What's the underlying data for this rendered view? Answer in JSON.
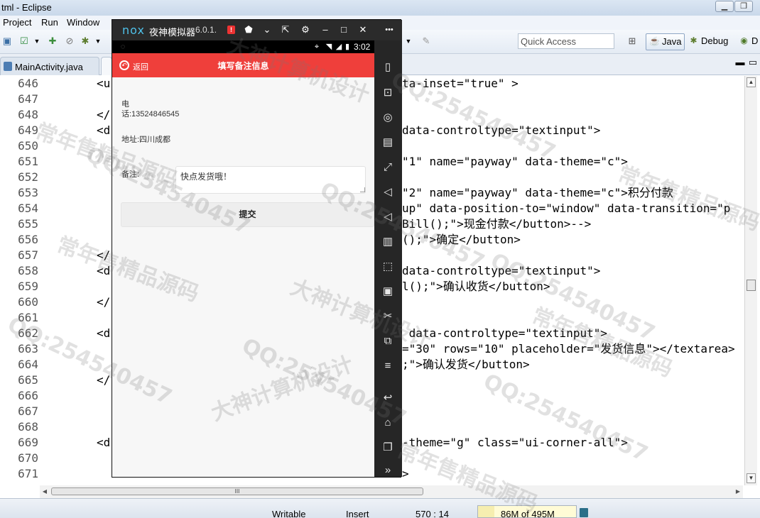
{
  "window": {
    "title": "tml - Eclipse",
    "menu": [
      "Project",
      "Run",
      "Window"
    ]
  },
  "toolbar": {
    "quick_access_placeholder": "Quick Access",
    "perspectives": [
      "Java",
      "Debug",
      "D"
    ]
  },
  "tabs": [
    {
      "label": "MainActivity.java"
    }
  ],
  "editor": {
    "lines": [
      {
        "num": "646",
        "code": "<u",
        "code_right": "ta-inset=\"true\" >"
      },
      {
        "num": "647",
        "code": "",
        "code_right": ""
      },
      {
        "num": "648",
        "code": "</",
        "code_right": ""
      },
      {
        "num": "649",
        "code": "<d",
        "code_right": "data-controltype=\"textinput\">"
      },
      {
        "num": "650",
        "code": "",
        "code_right": ""
      },
      {
        "num": "651",
        "code": "",
        "code_right": "\"1\" name=\"payway\" data-theme=\"c\">"
      },
      {
        "num": "652",
        "code": "",
        "code_right": ""
      },
      {
        "num": "653",
        "code": "",
        "code_right": "\"2\" name=\"payway\" data-theme=\"c\">积分付款"
      },
      {
        "num": "654",
        "code": "",
        "code_right": "up\" data-position-to=\"window\" data-transition=\"p"
      },
      {
        "num": "655",
        "code": "",
        "code_right": "Bill();\">现金付款</button>-->"
      },
      {
        "num": "656",
        "code": "",
        "code_right": "();\">确定</button>"
      },
      {
        "num": "657",
        "code": "</",
        "code_right": ""
      },
      {
        "num": "658",
        "code": "<d",
        "code_right": "data-controltype=\"textinput\">"
      },
      {
        "num": "659",
        "code": "",
        "code_right": "l();\">确认收货</button>"
      },
      {
        "num": "660",
        "code": "</",
        "code_right": ""
      },
      {
        "num": "661",
        "code": "",
        "code_right": ""
      },
      {
        "num": "662",
        "code": "<d",
        "code_right": " data-controltype=\"textinput\">"
      },
      {
        "num": "663",
        "code": "",
        "code_right": "=\"30\" rows=\"10\" placeholder=\"发货信息\"></textarea>"
      },
      {
        "num": "664",
        "code": "",
        "code_right": ";\">确认发货</button>"
      },
      {
        "num": "665",
        "code": "</",
        "code_right": ""
      },
      {
        "num": "666",
        "code": "",
        "code_right": ""
      },
      {
        "num": "667",
        "code": "",
        "code_right": ""
      },
      {
        "num": "668",
        "code": "",
        "code_right": ""
      },
      {
        "num": "669",
        "code": "<d",
        "code_right": "-theme=\"g\" class=\"ui-corner-all\">"
      },
      {
        "num": "670",
        "code": "",
        "code_right": ""
      },
      {
        "num": "671",
        "code": "",
        "code_right": ">"
      }
    ]
  },
  "hscroll_thumb_label": "III",
  "status": {
    "writable": "Writable",
    "insert": "Insert",
    "position": "570 : 14",
    "heap": "86M of 495M",
    "heap_used_fraction": 0.17
  },
  "emulator": {
    "logo": "nox",
    "name": "夜神模拟器",
    "version": "6.0.1.",
    "alert": "!",
    "status_time": "3:02",
    "sidebar_more": "•••"
  },
  "app": {
    "back_label": "返回",
    "title": "填写备注信息",
    "phone_label": "电话:13524846545",
    "address_label": "地址:四川成都",
    "remark_label": "备注:",
    "remark_value": "快点发货哦！",
    "submit_label": "提交"
  },
  "watermarks": [
    "常年售精品源码",
    "QQ:254540457",
    "大神计算机设计",
    "QQ:254540457",
    "常年售精品源码",
    "QQ:254540457",
    "常年售精品源码",
    "大神计算机设计",
    "QQ:254540457",
    "QQ:254540457",
    "常年售精品源码",
    "大神计算机设计",
    "QQ:254540457",
    "常年售精品源码",
    "QQ:254540457"
  ],
  "colors": {
    "app_bar": "#ef3f3b",
    "nox_logo": "#4fc1e9"
  }
}
